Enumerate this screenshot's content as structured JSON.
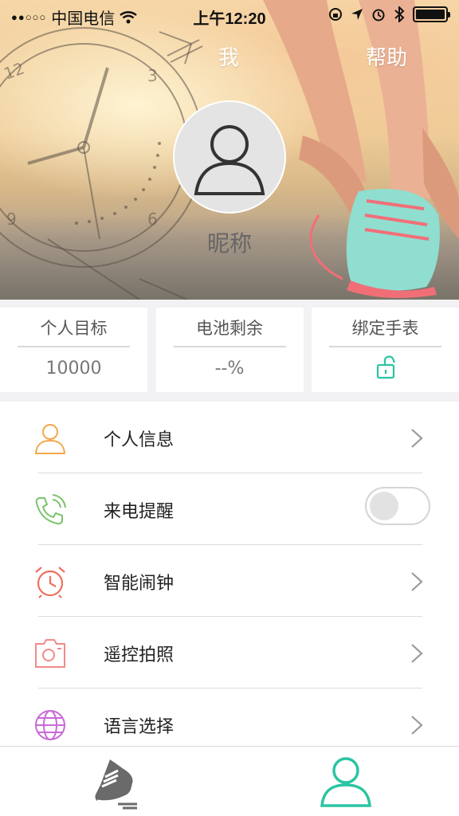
{
  "status_bar": {
    "carrier": "中国电信",
    "time": "上午12:20"
  },
  "header": {
    "tab_me": "我",
    "tab_help": "帮助",
    "nickname": "昵称",
    "avatar_icon": "user-icon"
  },
  "stats": [
    {
      "label": "个人目标",
      "value": "10000"
    },
    {
      "label": "电池剩余",
      "value": "--%"
    },
    {
      "label": "绑定手表",
      "icon": "unlock-icon"
    }
  ],
  "menu": [
    {
      "label": "个人信息",
      "icon": "user-icon",
      "color": "#f5a74a",
      "control": "chevron"
    },
    {
      "label": "来电提醒",
      "icon": "phone-icon",
      "color": "#7ac36a",
      "control": "toggle",
      "toggle_on": false
    },
    {
      "label": "智能闹钟",
      "icon": "alarm-clock-icon",
      "color": "#ef6f5e",
      "control": "chevron"
    },
    {
      "label": "遥控拍照",
      "icon": "camera-icon",
      "color": "#f08a8a",
      "control": "chevron"
    },
    {
      "label": "语言选择",
      "icon": "globe-icon",
      "color": "#c86ad6",
      "control": "chevron"
    }
  ],
  "tabbar": {
    "items": [
      {
        "name": "sport",
        "icon": "running-shoe-icon",
        "active": false
      },
      {
        "name": "me",
        "icon": "user-icon",
        "active": true
      }
    ],
    "active_color": "#2bc4a2",
    "inactive_color": "#555555"
  },
  "colors": {
    "accent": "#2bc4a2",
    "background": "#f2f2f4"
  }
}
